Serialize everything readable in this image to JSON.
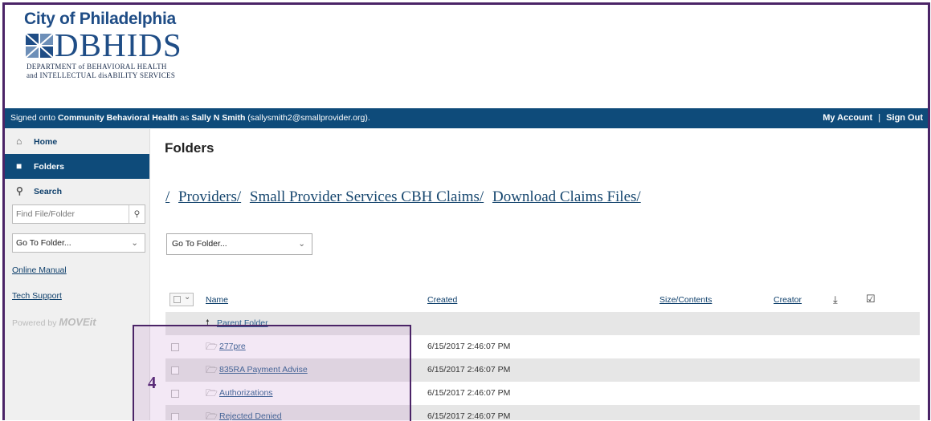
{
  "header": {
    "city": "City of Philadelphia",
    "brand": "DBHIDS",
    "subtitle_line1": "DEPARTMENT of BEHAVIORAL HEALTH",
    "subtitle_line2": "and INTELLECTUAL disABILITY SERVICES"
  },
  "topbar": {
    "prefix": "Signed onto ",
    "org": "Community Behavioral Health",
    "middle": " as ",
    "user": "Sally N Smith",
    "email": " (sallysmith2@smallprovider.org).",
    "my_account": "My Account",
    "separator": "|",
    "sign_out": "Sign Out"
  },
  "sidebar": {
    "home": "Home",
    "folders": "Folders",
    "search": "Search",
    "search_placeholder": "Find File/Folder",
    "goto": "Go To Folder...",
    "manual": "Online Manual",
    "support": "Tech Support",
    "powered": "Powered by",
    "powered_brand": "MOVEit"
  },
  "main": {
    "title": "Folders",
    "breadcrumb": [
      "/",
      "Providers/",
      "Small Provider Services CBH Claims/",
      "Download Claims Files/"
    ],
    "goto": "Go To Folder...",
    "columns": {
      "name": "Name",
      "created": "Created",
      "size": "Size/Contents",
      "creator": "Creator"
    },
    "parent": "Parent Folder",
    "rows": [
      {
        "name": "277pre",
        "created": "6/15/2017 2:46:07 PM"
      },
      {
        "name": "835RA Payment Advise",
        "created": "6/15/2017 2:46:07 PM"
      },
      {
        "name": "Authorizations",
        "created": "6/15/2017 2:46:07 PM"
      },
      {
        "name": "Rejected Denied",
        "created": "6/15/2017 2:46:07 PM"
      }
    ]
  },
  "callout": {
    "number": "4"
  },
  "colors": {
    "brand_blue": "#0e4b7a",
    "frame_purple": "#4b2467"
  }
}
